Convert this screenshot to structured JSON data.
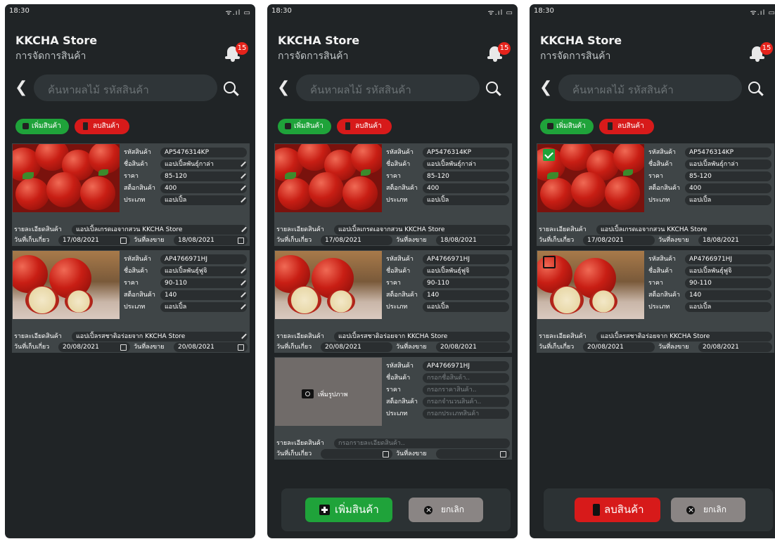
{
  "status": {
    "time": "18:30",
    "signal": "ᯤ.ıl ▭"
  },
  "app": {
    "store": "KKCHA Store",
    "subtitle": "การจัดการสินค้า",
    "notification_count": "15"
  },
  "search": {
    "placeholder": "ค้นหาผลไม้ รหัสสินค้า"
  },
  "actions": {
    "add": "เพิ่มสินค้า",
    "delete": "ลบสินค้า"
  },
  "labels": {
    "code": "รหัสสินค้า",
    "name": "ชื่อสินค้า",
    "price": "ราคา",
    "stock": "สต็อกสินค้า",
    "type": "ประเภท",
    "detail": "รายละเอียดสินค้า",
    "harvest": "วันที่เก็บเกี่ยว",
    "sale": "วันที่ลงขาย"
  },
  "products": [
    {
      "code": "AP5476314KP",
      "name": "แอปเปิ้ลพันธุ์กาล่า",
      "price": "85-120",
      "stock": "400",
      "type": "แอปเปิ้ล",
      "detail": "แอปเปิ้ลเกรดเอจากสวน KKCHA Store",
      "harvest": "17/08/2021",
      "sale": "18/08/2021"
    },
    {
      "code": "AP4766971HJ",
      "name": "แอปเปิ้ลพันธุ์ฟูจิ",
      "price": "90-110",
      "stock": "140",
      "type": "แอปเปิ้ล",
      "detail": "แอปเปิ้ลรสชาติอร่อยจาก KKCHA Store",
      "harvest": "20/08/2021",
      "sale": "20/08/2021"
    }
  ],
  "new_product": {
    "code": "AP4766971HJ",
    "add_photo": "เพิ่มรูปภาพ",
    "name_ph": "กรอกชื่อสินค้า..",
    "price_ph": "กรอกราคาสินค้า..",
    "stock_ph": "กรอกจำนวนสินค้า..",
    "type_ph": "กรอกประเภทสินค้า",
    "detail_ph": "กรอกรายละเอียดสินค้า.."
  },
  "footer": {
    "add": "เพิ่มสินค้า",
    "delete": "ลบสินค้า",
    "cancel": "ยกเลิก"
  },
  "colors": {
    "background": "#202426",
    "card": "#3f4547",
    "green": "#1fa33a",
    "red": "#d71a1a",
    "badge": "#e5231b"
  },
  "icons": [
    "bell-icon",
    "search-icon",
    "back-icon",
    "edit-icon",
    "calendar-icon",
    "camera-icon",
    "trash-icon",
    "plus-icon",
    "close-icon",
    "checkbox-icon"
  ]
}
